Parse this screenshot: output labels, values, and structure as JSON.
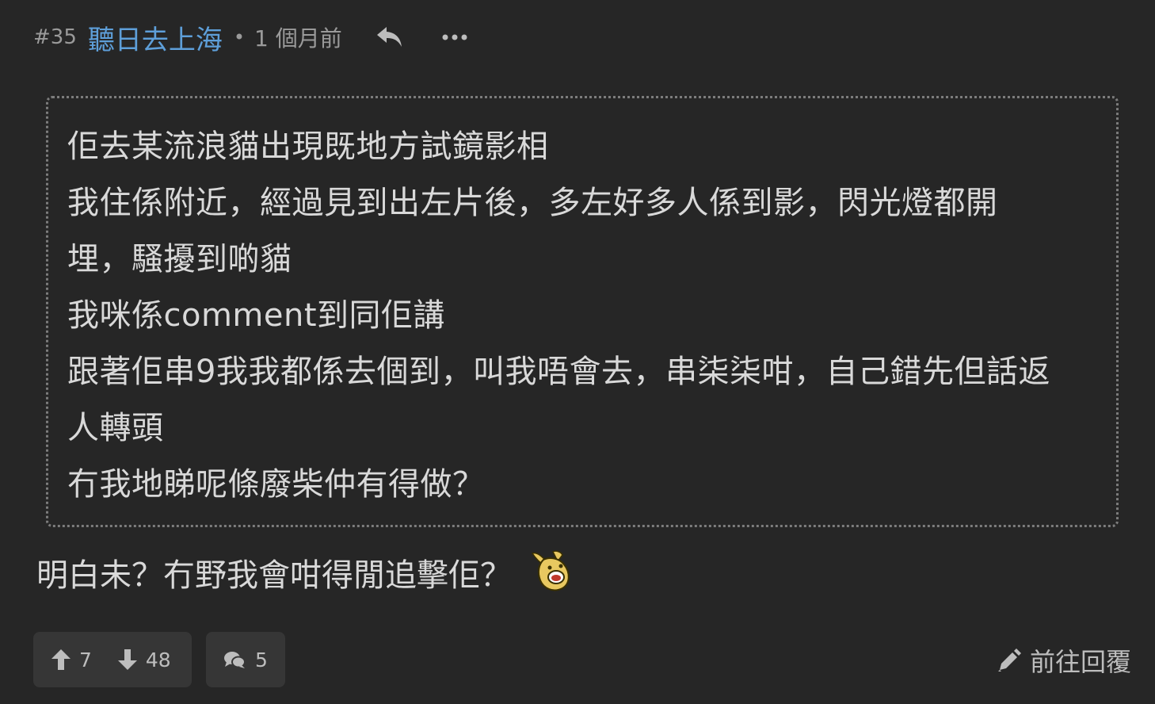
{
  "post": {
    "floor": "#35",
    "username": "聽日去上海",
    "separator": "•",
    "time_ago": "1 個月前",
    "icons": {
      "reply": "reply-arrow-icon",
      "more": "more-dots-icon",
      "upvote": "arrow-up-icon",
      "downvote": "arrow-down-icon",
      "comments": "chat-bubbles-icon",
      "goto_reply": "pen-arrow-icon",
      "sticker": "banana-emoji-sticker"
    },
    "quote_lines": [
      "佢去某流浪貓出現既地方試鏡影相",
      "我住係附近，經過見到出左片後，多左好多人係到影，閃光燈都開",
      "埋，騷擾到啲貓",
      "我咪係comment到同佢講",
      "跟著佢串9我我都係去個到，叫我唔會去，串柒柒咁，自己錯先但話返",
      "人轉頭",
      "冇我地睇呢條廢柴仲有得做？"
    ],
    "body": "明白未？冇野我會咁得閒追擊佢？",
    "upvotes": "7",
    "downvotes": "48",
    "comments": "5",
    "goto_reply_label": "前往回覆"
  },
  "colors": {
    "background": "#262626",
    "username": "#5e9fd9",
    "text": "#d9d9d9",
    "muted": "#9a9a9a",
    "button_bg": "#363636"
  }
}
